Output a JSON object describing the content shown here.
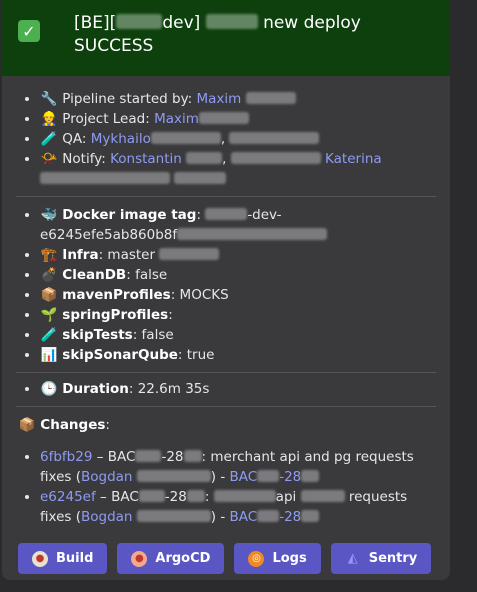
{
  "header": {
    "title_pre": "[BE][",
    "title_mid": "dev]",
    "title_post": "new deploy",
    "title_line2": "SUCCESS",
    "check_symbol": "✓"
  },
  "info": [
    {
      "emoji": "🔧",
      "label": "Pipeline started by:",
      "link": "Maxim"
    },
    {
      "emoji": "👷",
      "label": "Project Lead:",
      "link": "Maxim"
    },
    {
      "emoji": "🧪",
      "label": "QA:",
      "link": "Mykhailo"
    },
    {
      "emoji": "📯",
      "label": "Notify:",
      "link": "Konstantin",
      "link2": "Katerina"
    }
  ],
  "params": {
    "docker_label": "Docker image tag",
    "docker_value_pre": "",
    "docker_value_mid": "-dev-",
    "docker_value_line2": "e6245efe5ab860b8f",
    "infra_label": "Infra",
    "infra_value": "master",
    "cleandb_label": "CleanDB",
    "cleandb_value": "false",
    "maven_label": "mavenProfiles",
    "maven_value": "MOCKS",
    "spring_label": "springProfiles",
    "spring_value": "",
    "skiptests_label": "skipTests",
    "skiptests_value": "false",
    "sonar_label": "skipSonarQube",
    "sonar_value": "true"
  },
  "duration": {
    "label": "Duration",
    "value": "22.6m 35s"
  },
  "changes": {
    "title": "Changes",
    "items": [
      {
        "hash": "6fbfb29",
        "ticket_pre": "BAC",
        "ticket_mid": "-28",
        "message": "merchant api and pg requests",
        "message2": "fixes (",
        "author": "Bogdan",
        "link_pre": "BAC",
        "link_mid": "-28"
      },
      {
        "hash": "e6245ef",
        "ticket_pre": "BAC",
        "ticket_mid": "-28",
        "message": "api",
        "message_b": "requests",
        "message2": "fixes (",
        "author": "Bogdan",
        "link_pre": "BAC",
        "link_mid": "-28"
      }
    ]
  },
  "buttons": [
    {
      "label": "Build",
      "icon": "jenkins-icon",
      "color": "#e8e0d0"
    },
    {
      "label": "ArgoCD",
      "icon": "argocd-icon",
      "color": "#f4a88c"
    },
    {
      "label": "Logs",
      "icon": "grafana-icon",
      "color": "#f08a24"
    },
    {
      "label": "Sentry",
      "icon": "sentry-icon",
      "color": "#8e9bf2"
    }
  ]
}
